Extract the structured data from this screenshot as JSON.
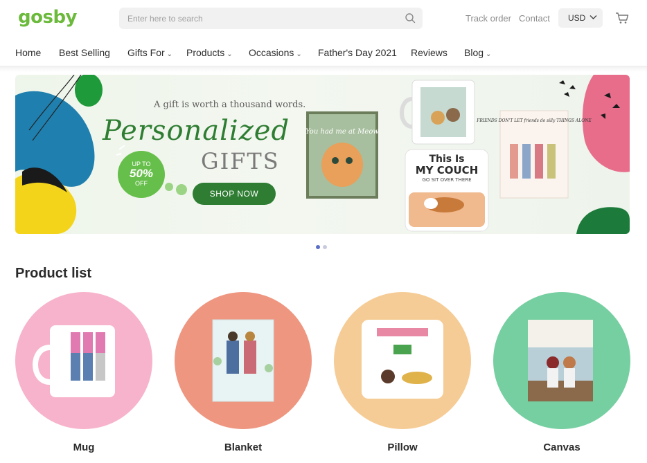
{
  "header": {
    "logo": "gosby",
    "search_placeholder": "Enter here to search",
    "track_order": "Track order",
    "contact": "Contact",
    "currency": "USD"
  },
  "nav": [
    {
      "label": "Home",
      "dropdown": false
    },
    {
      "label": "Best Selling",
      "dropdown": false
    },
    {
      "label": "Gifts For",
      "dropdown": true
    },
    {
      "label": "Products",
      "dropdown": true
    },
    {
      "label": "Occasions",
      "dropdown": true
    },
    {
      "label": "Father's Day 2021",
      "dropdown": false
    },
    {
      "label": "Reviews",
      "dropdown": false
    },
    {
      "label": "Blog",
      "dropdown": true
    }
  ],
  "banner": {
    "tagline": "A gift is worth a thousand words.",
    "headline": "Personalized",
    "subheadline": "GIFTS",
    "badge_line1": "UP TO",
    "badge_line2": "50%",
    "badge_line3": "OFF",
    "cta": "SHOP NOW",
    "pillow_text1": "This Is",
    "pillow_text2": "MY COUCH",
    "pillow_text3": "GO SIT OVER THERE",
    "canvas_text": "You had me at Meow",
    "friends_text": "FRIENDS DON'T LET friends do silly THINGS ALONE",
    "slides_total": 2,
    "slide_active": 1
  },
  "product_list": {
    "title": "Product list",
    "items": [
      {
        "name": "Mug",
        "bg": "#f7b3cb"
      },
      {
        "name": "Blanket",
        "bg": "#ee9680"
      },
      {
        "name": "Pillow",
        "bg": "#f6cc96"
      },
      {
        "name": "Canvas",
        "bg": "#76cfa1"
      }
    ]
  },
  "colors": {
    "brand_green": "#6cba3c",
    "cta_green": "#2e7d32",
    "dot_active": "#5b6fc7",
    "dot_inactive": "#c8cbe0"
  }
}
